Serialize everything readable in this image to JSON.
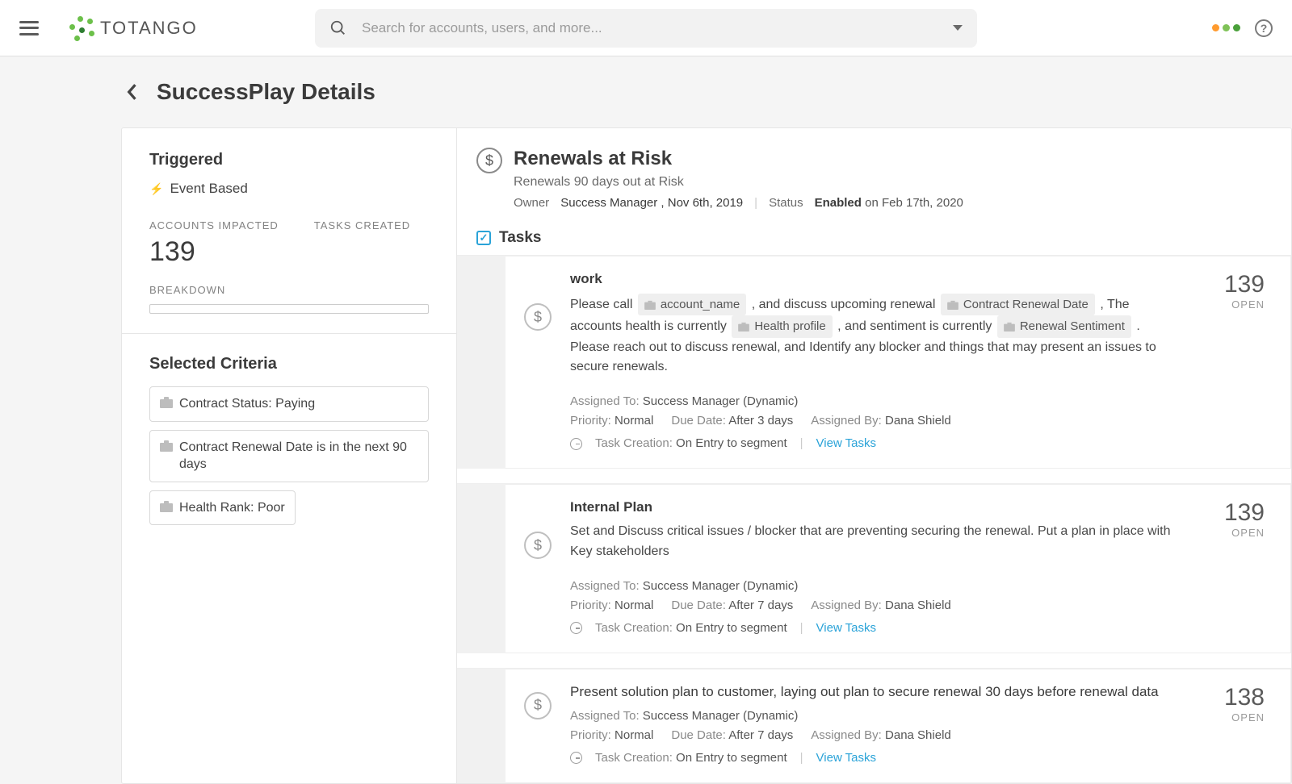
{
  "header": {
    "logo_text": "TOTANGO",
    "search_placeholder": "Search for accounts, users, and more..."
  },
  "page": {
    "title": "SuccessPlay Details"
  },
  "sidebar": {
    "triggered_title": "Triggered",
    "trigger_type": "Event Based",
    "metrics": {
      "impacted_label": "ACCOUNTS IMPACTED",
      "impacted_value": "139",
      "tasks_label": "TASKS CREATED"
    },
    "breakdown_label": "BREAKDOWN",
    "criteria_title": "Selected Criteria",
    "criteria": [
      "Contract Status: Paying",
      "Contract Renewal Date is in the next 90 days",
      "Health Rank: Poor"
    ]
  },
  "play": {
    "title": "Renewals at Risk",
    "subtitle": "Renewals 90 days out at Risk",
    "owner_label": "Owner",
    "owner_value": "Success Manager , Nov 6th, 2019",
    "status_label": "Status",
    "status_value": "Enabled",
    "status_date": "on Feb 17th, 2020",
    "tasks_heading": "Tasks"
  },
  "tasks": [
    {
      "title": "work",
      "count": "139",
      "count_label": "OPEN",
      "desc_parts": {
        "p0": "Please call ",
        "tag0": "account_name",
        "p1": " , and discuss upcoming renewal ",
        "tag1": "Contract Renewal Date",
        "p2": " ,  The accounts health is currently ",
        "tag2": "Health profile",
        "p3": " , and sentiment is currently ",
        "tag3": "Renewal Sentiment",
        "p4": " .  Please reach out to discuss renewal, and Identify any blocker and things that may present an issues to secure renewals."
      },
      "assigned_to": "Success Manager (Dynamic)",
      "priority": "Normal",
      "due": "After 3 days",
      "assigned_by": "Dana Shield",
      "creation": "On Entry to segment",
      "view": "View Tasks"
    },
    {
      "title": "Internal Plan",
      "count": "139",
      "count_label": "OPEN",
      "desc_plain": "Set and Discuss critical issues / blocker that are preventing securing the renewal. Put a plan in place with Key stakeholders",
      "assigned_to": "Success Manager (Dynamic)",
      "priority": "Normal",
      "due": "After 7 days",
      "assigned_by": "Dana Shield",
      "creation": "On Entry to segment",
      "view": "View Tasks"
    },
    {
      "title": "Present solution plan to customer, laying out plan to secure renewal 30 days before renewal data",
      "count": "138",
      "count_label": "OPEN",
      "assigned_to": "Success Manager (Dynamic)",
      "priority": "Normal",
      "due": "After 7 days",
      "assigned_by": "Dana Shield",
      "creation": "On Entry to segment",
      "view": "View Tasks"
    }
  ],
  "labels": {
    "assigned_to": "Assigned To:",
    "priority": "Priority:",
    "due": "Due Date:",
    "assigned_by": "Assigned By:",
    "task_creation": "Task Creation:"
  }
}
